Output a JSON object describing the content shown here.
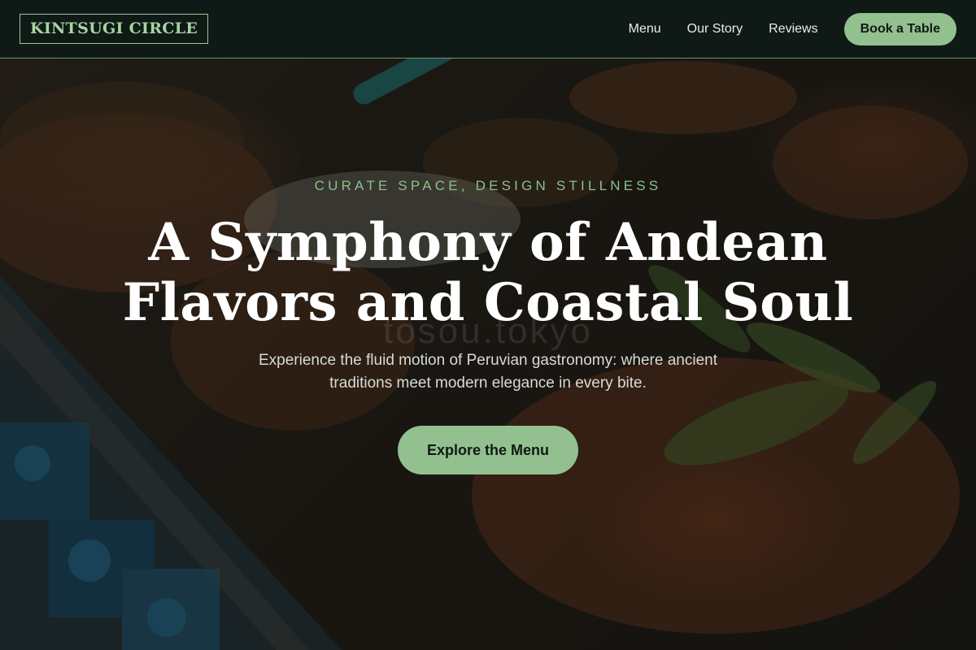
{
  "nav": {
    "logo": "KINTSUGI CIRCLE",
    "links": [
      "Menu",
      "Our Story",
      "Reviews"
    ],
    "cta": "Book a Table"
  },
  "hero": {
    "eyebrow": "CURATE SPACE, DESIGN STILLNESS",
    "headline_line1": "A Symphony of Andean",
    "headline_line2": "Flavors and Coastal Soul",
    "subcopy": "Experience the fluid motion of Peruvian gastronomy: where ancient traditions meet modern elegance in every bite.",
    "cta": "Explore the Menu",
    "background_watermark": "tosou.tokyo"
  },
  "colors": {
    "accent": "#93c08f",
    "nav_bg": "#0f1a16",
    "headline": "#ffffff"
  }
}
